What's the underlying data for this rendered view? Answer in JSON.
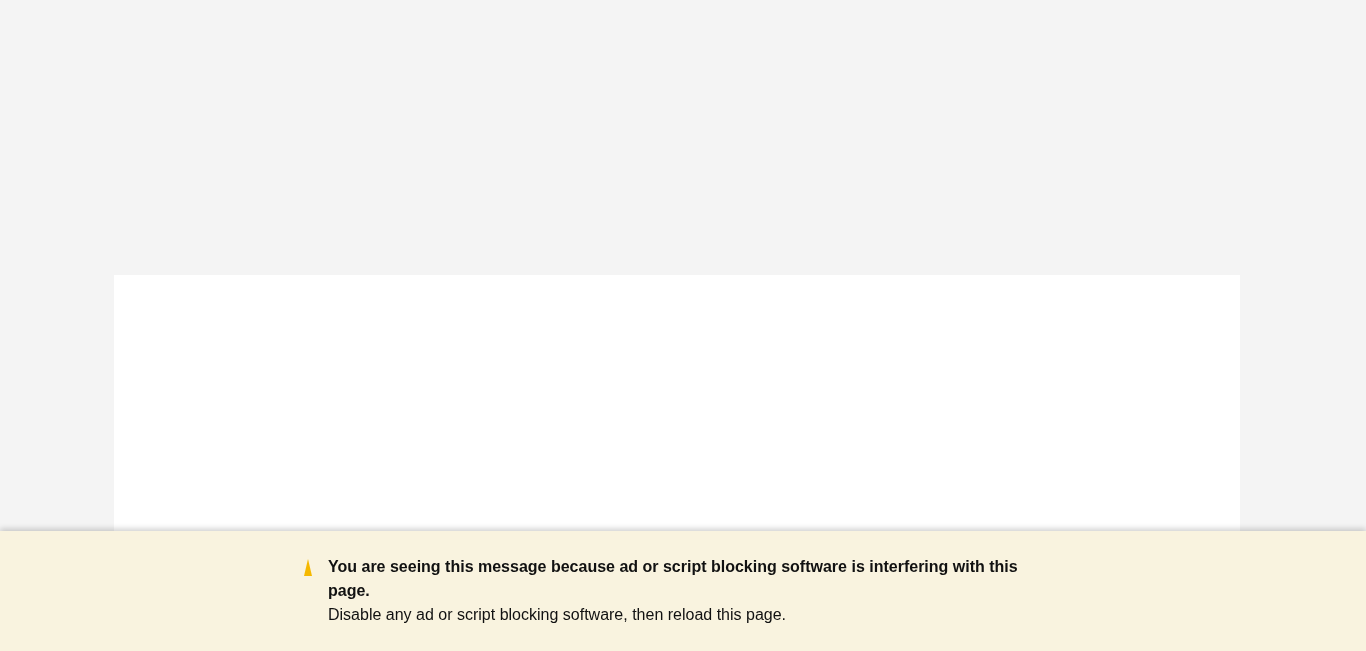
{
  "notice": {
    "title": "You are seeing this message because ad or script blocking software is interfering with this page.",
    "message": "Disable any ad or script blocking software, then reload this page."
  }
}
